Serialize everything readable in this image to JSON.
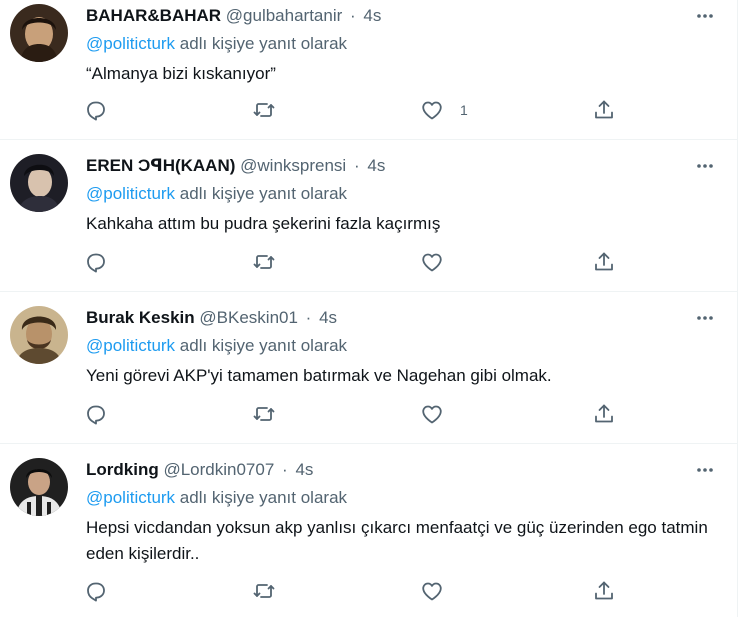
{
  "tweets": [
    {
      "name": "BAHAR&BAHAR",
      "handle": "@gulbahartanir",
      "dot": "·",
      "time": "4s",
      "reply_prefix": "",
      "reply_mention": "@politicturk",
      "reply_suffix": " adlı kişiye yanıt olarak",
      "text": "“Almanya bizi kıskanıyor”",
      "reply_count": "",
      "retweet_count": "",
      "like_count": "1",
      "avatar_colors": [
        "#3a2a1e",
        "#c8a07a"
      ]
    },
    {
      "name": "EREN ϽꟼH(KAAN)",
      "handle": "@winksprensi",
      "dot": "·",
      "time": "4s",
      "reply_prefix": "",
      "reply_mention": "@politicturk",
      "reply_suffix": " adlı kişiye yanıt olarak",
      "text": "Kahkaha attım bu pudra şekerini fazla kaçırmış",
      "reply_count": "",
      "retweet_count": "",
      "like_count": "",
      "avatar_colors": [
        "#1e1e26",
        "#d8c2ae"
      ]
    },
    {
      "name": "Burak Keskin",
      "handle": "@BKeskin01",
      "dot": "·",
      "time": "4s",
      "reply_prefix": "",
      "reply_mention": "@politicturk",
      "reply_suffix": " adlı kişiye yanıt olarak",
      "text": "Yeni görevi AKP'yi tamamen batırmak ve Nagehan gibi olmak.",
      "reply_count": "",
      "retweet_count": "",
      "like_count": "",
      "avatar_colors": [
        "#5e4a30",
        "#b8926a"
      ]
    },
    {
      "name": "Lordking",
      "handle": "@Lordkin0707",
      "dot": "·",
      "time": "4s",
      "reply_prefix": "",
      "reply_mention": "@politicturk",
      "reply_suffix": " adlı kişiye yanıt olarak",
      "text": "Hepsi vicdandan yoksun akp yanlısı çıkarcı menfaatçi ve güç üzerinden ego tatmin eden kişilerdir..",
      "reply_count": "",
      "retweet_count": "",
      "like_count": "",
      "avatar_colors": [
        "#202020",
        "#e8e8e8"
      ]
    }
  ],
  "colors": {
    "text": "#0f1419",
    "secondary": "#536471",
    "link": "#1d9bf0",
    "border": "#eff3f4"
  },
  "icons": {
    "reply": "reply-icon",
    "retweet": "retweet-icon",
    "like": "like-icon",
    "share": "share-icon",
    "more": "more-icon"
  }
}
